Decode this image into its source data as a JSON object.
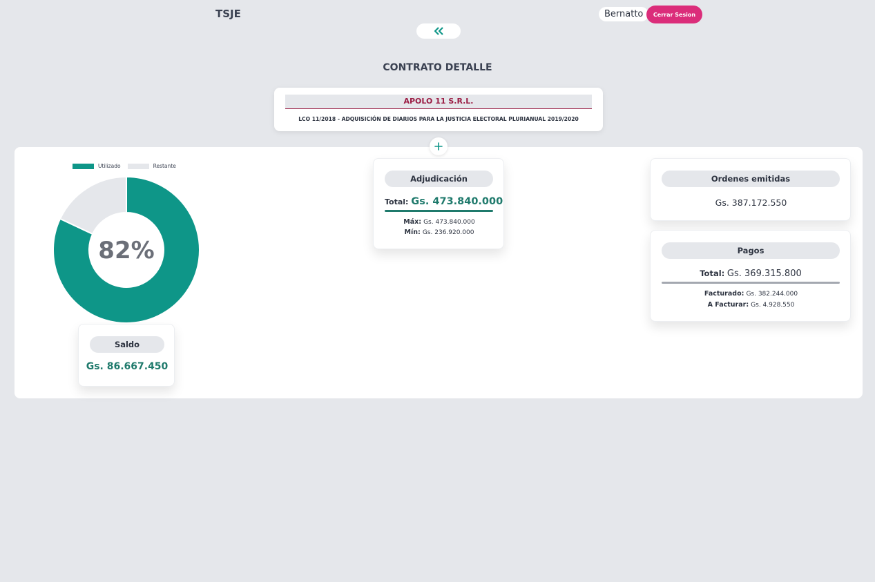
{
  "header": {
    "app_title": "TSJE",
    "user_name": "Bernatto",
    "logout_label": "Cerrar Sesion"
  },
  "page_title": "CONTRATO DETALLE",
  "contract": {
    "company": "APOLO 11 S.R.L.",
    "description": "LCO 11/2018 - ADQUISICIÓN DE DIARIOS PARA LA JUSTICIA ELECTORAL PLURIANUAL 2019/2020"
  },
  "colors": {
    "accent": "#0e9688",
    "remaining": "#e5e7eb",
    "brand_pink": "#db2d7a",
    "company_red": "#9b1c43"
  },
  "icons": {
    "back": "double-chevron-left-icon",
    "expand": "plus-icon"
  },
  "chart_data": {
    "type": "pie",
    "categories": [
      "Utilizado",
      "Restante"
    ],
    "values": [
      82,
      18
    ],
    "center_label": "82%",
    "legend": "top"
  },
  "saldo": {
    "title": "Saldo",
    "value": "Gs. 86.667.450"
  },
  "adjudicacion": {
    "title": "Adjudicación",
    "total_label": "Total:",
    "total_value": "Gs. 473.840.000",
    "max_label": "Máx:",
    "max_value": "Gs. 473.840.000",
    "min_label": "Mín:",
    "min_value": "Gs. 236.920.000"
  },
  "ordenes": {
    "title": "Ordenes emitidas",
    "value": "Gs. 387.172.550"
  },
  "pagos": {
    "title": "Pagos",
    "total_label": "Total:",
    "total_value": "Gs. 369.315.800",
    "facturado_label": "Facturado:",
    "facturado_value": "Gs. 382.244.000",
    "afacturar_label": "A Facturar:",
    "afacturar_value": "Gs. 4.928.550"
  }
}
